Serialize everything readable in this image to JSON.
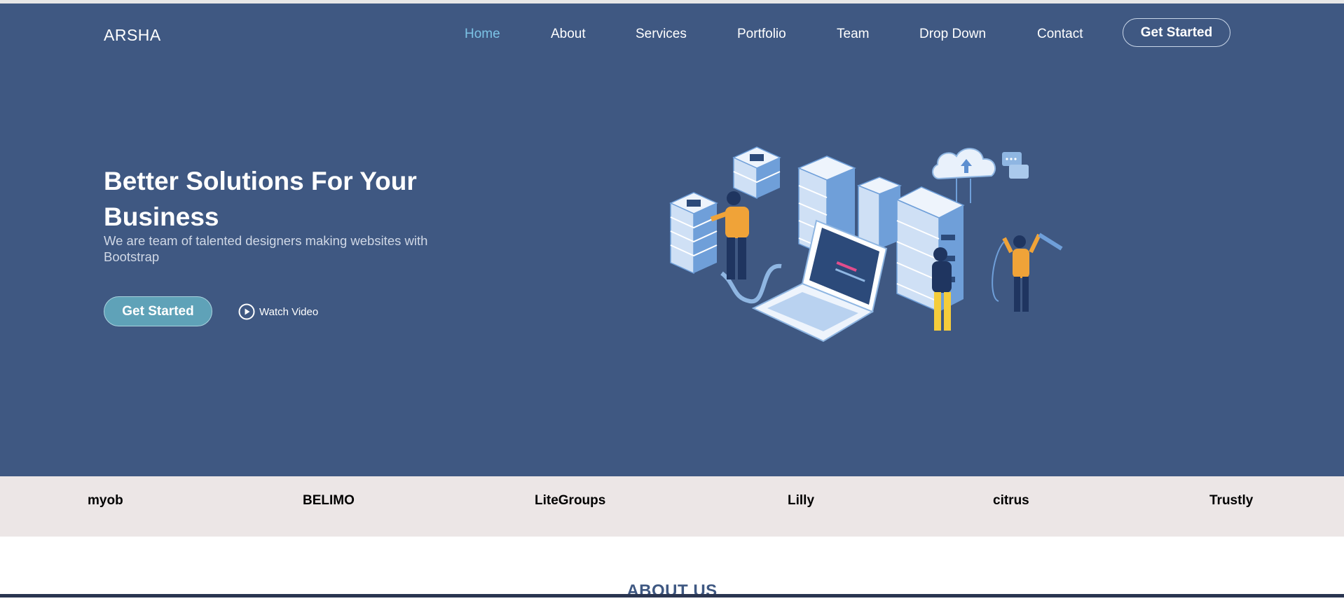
{
  "brand": {
    "logo_text": "ARSHA"
  },
  "nav": {
    "items": [
      {
        "label": "Home",
        "active": true
      },
      {
        "label": "About"
      },
      {
        "label": "Services"
      },
      {
        "label": "Portfolio"
      },
      {
        "label": "Team"
      },
      {
        "label": "Drop Down"
      },
      {
        "label": "Contact"
      }
    ],
    "cta_label": "Get Started"
  },
  "hero": {
    "title": "Better Solutions For Your Business",
    "subtitle": "We are team of talented designers making websites with Bootstrap",
    "cta_label": "Get Started",
    "video_label": "Watch Video",
    "illustration_icon": "server-cloud-illustration"
  },
  "clients": [
    "myob",
    "BELIMO",
    "LiteGroups",
    "Lilly",
    "citrus",
    "Trustly"
  ],
  "about": {
    "heading": "ABOUT US"
  },
  "colors": {
    "hero_bg": "#3f5882",
    "nav_active": "#7cc3e6",
    "hero_button": "#5fa2b8",
    "clients_bg": "#ece6e6",
    "heading_accent": "#3f5882"
  }
}
